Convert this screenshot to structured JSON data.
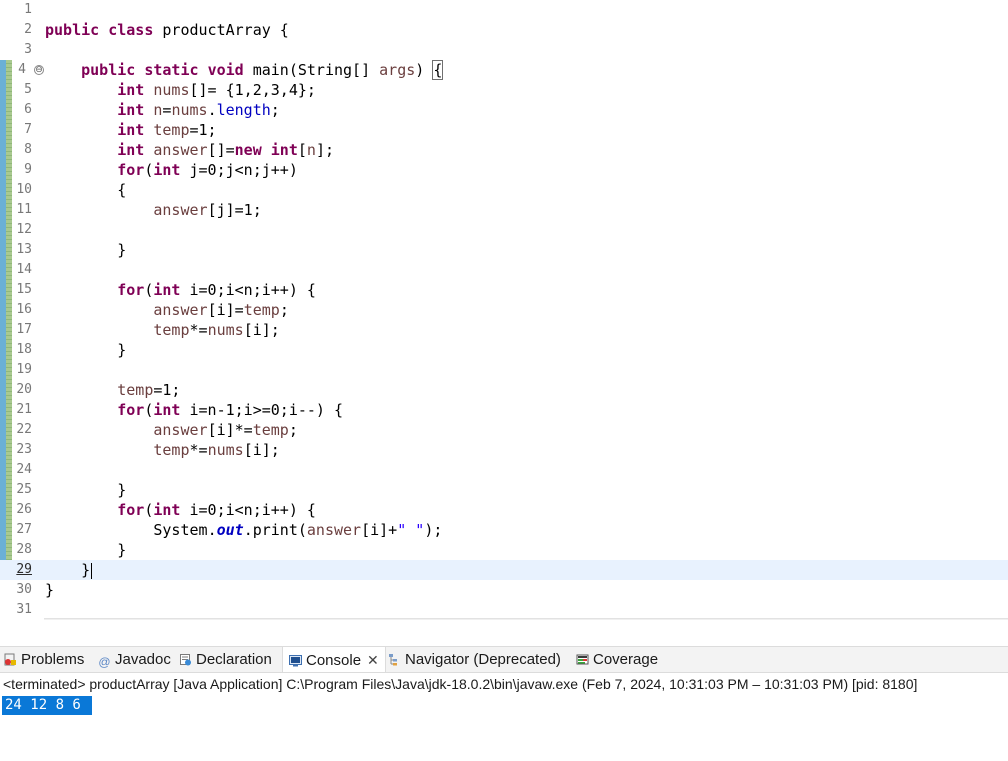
{
  "editor": {
    "line_numbers": [
      "1",
      "2",
      "3",
      "4",
      "5",
      "6",
      "7",
      "8",
      "9",
      "10",
      "11",
      "12",
      "13",
      "14",
      "15",
      "16",
      "17",
      "18",
      "19",
      "20",
      "21",
      "22",
      "23",
      "24",
      "25",
      "26",
      "27",
      "28",
      "29",
      "30",
      "31"
    ],
    "current_line": "29",
    "fold_marker": "⊖",
    "code": {
      "l2": {
        "kw1": "public",
        "kw2": "class",
        "name": " productArray {"
      },
      "l4": {
        "kw1": "public",
        "kw2": "static",
        "kw3": "void",
        "rest": " main(String[] ",
        "args": "args",
        ") ": ") ",
        "brace": "{"
      },
      "l5": {
        "kw": "int",
        "var": "nums",
        "rest": "[]= {1,2,3,4};"
      },
      "l6": {
        "kw": "int",
        "var": "n",
        "eq": "=",
        "var2": "nums",
        "dot": ".",
        "fld": "length",
        "semi": ";"
      },
      "l7": {
        "kw": "int",
        "var": "temp",
        "rest": "=1;"
      },
      "l8": {
        "kw": "int",
        "var": "answer",
        "rest1": "[]=",
        "kw2": "new",
        "kw3": "int",
        "rest2": "[",
        "var2": "n",
        "rest3": "];"
      },
      "l9": {
        "kw": "for",
        "rest1": "(",
        "kw2": "int",
        "rest2": " j=0;j<n;j++)"
      },
      "l10": "{",
      "l11": {
        "var": "answer",
        "rest": "[j]=1;"
      },
      "l13": "}",
      "l15": {
        "kw": "for",
        "rest1": "(",
        "kw2": "int",
        "rest2": " i=0;i<n;i++) {"
      },
      "l16": {
        "var": "answer",
        "rest1": "[i]=",
        "var2": "temp",
        "rest2": ";"
      },
      "l17": {
        "var": "temp",
        "rest1": "*=",
        "var2": "nums",
        "rest2": "[i];"
      },
      "l18": "}",
      "l20": {
        "var": "temp",
        "rest": "=1;"
      },
      "l21": {
        "kw": "for",
        "rest1": "(",
        "kw2": "int",
        "rest2": " i=n-1;i>=0;i--) {"
      },
      "l22": {
        "var": "answer",
        "rest1": "[i]*=",
        "var2": "temp",
        "rest2": ";"
      },
      "l23": {
        "var": "temp",
        "rest1": "*=",
        "var2": "nums",
        "rest2": "[i];"
      },
      "l25": "}",
      "l26": {
        "kw": "for",
        "rest1": "(",
        "kw2": "int",
        "rest2": " i=0;i<n;i++) {"
      },
      "l27": {
        "cls": "System",
        "dot": ".",
        "fld": "out",
        "rest1": ".print(",
        "var": "answer",
        "rest2": "[i]+",
        "str": "\" \"",
        "rest3": ");"
      },
      "l28": "}",
      "l29": "}",
      "l30": "}"
    }
  },
  "views": {
    "tabs": [
      {
        "label": "Problems",
        "icon": "problems-icon"
      },
      {
        "label": "Javadoc",
        "icon": "javadoc-icon"
      },
      {
        "label": "Declaration",
        "icon": "declaration-icon"
      },
      {
        "label": "Console",
        "icon": "console-icon",
        "active": true
      },
      {
        "label": "Navigator (Deprecated)",
        "icon": "navigator-icon"
      },
      {
        "label": "Coverage",
        "icon": "coverage-icon"
      }
    ],
    "close_glyph": "✕",
    "javadoc_glyph": "@"
  },
  "console": {
    "status": "<terminated> productArray [Java Application] C:\\Program Files\\Java\\jdk-18.0.2\\bin\\javaw.exe  (Feb 7, 2024, 10:31:03 PM – 10:31:03 PM) [pid: 8180]",
    "output": "24 12 8 6 "
  },
  "colors": {
    "keyword": "#7f0055",
    "local_variable": "#6a3e3e",
    "field": "#0000c0",
    "string": "#2a00ff",
    "current_line": "#e8f2fe",
    "selection": "#0a78d7"
  }
}
